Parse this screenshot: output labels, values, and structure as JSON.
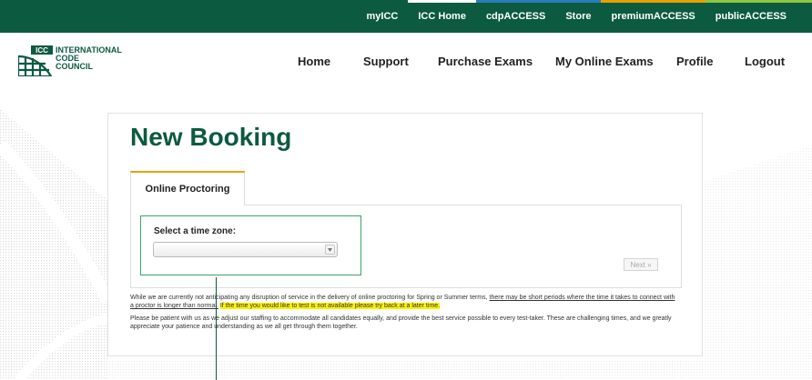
{
  "colors": {
    "brand_green": "#0c5a40",
    "accent_orange": "#e8a000",
    "highlight_yellow": "#fff200",
    "focus_green": "#3aa46a"
  },
  "top_nav": [
    {
      "label": "myICC",
      "strip": ""
    },
    {
      "label": "ICC Home",
      "strip": "#ffffff"
    },
    {
      "label": "cdpACCESS",
      "strip": "#2a7db8"
    },
    {
      "label": "Store",
      "strip": "#2a7db8"
    },
    {
      "label": "premiumACCESS",
      "strip": "#e8a000"
    },
    {
      "label": "publicACCESS",
      "strip": "#8dc63f"
    }
  ],
  "logo": {
    "badge": "ICC",
    "line1": "INTERNATIONAL",
    "line2": "CODE",
    "line3": "COUNCIL"
  },
  "main_nav": [
    "Home",
    "Support",
    "Purchase Exams",
    "My Online Exams",
    "Profile",
    "Logout"
  ],
  "page": {
    "title": "New Booking",
    "tab_label": "Online Proctoring",
    "timezone_label": "Select a time zone:",
    "timezone_value": "",
    "next_label": "Next »"
  },
  "notice": {
    "p1_plain": "While we are currently not anticipating any disruption of service in the delivery of online proctoring for Spring or Summer terms, ",
    "p1_underlined": "there may be short periods where the time it takes to connect with a proctor is longer than normal.",
    "p1_highlight": "If the time you would like to test is not available please try back at a later time.",
    "p2": "Please be patient with us as we adjust our staffing to accommodate all candidates equally, and provide the best service possible to every test-taker. These are challenging times, and we greatly appreciate your patience and understanding as we all get through them together."
  }
}
